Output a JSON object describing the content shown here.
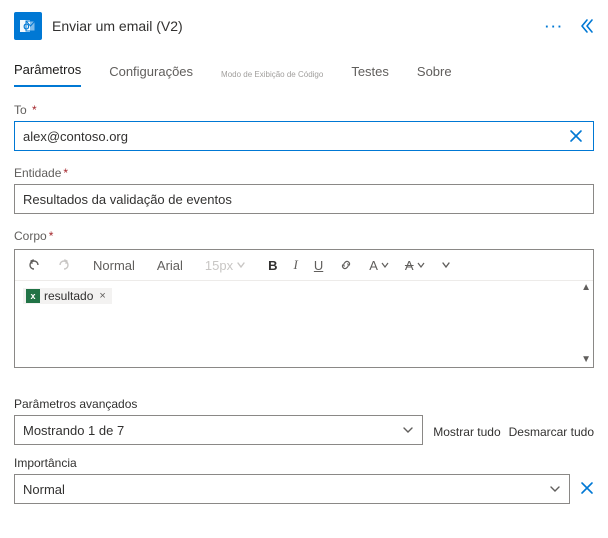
{
  "header": {
    "title": "Enviar um email (V2)"
  },
  "tabs": {
    "parametros": "Parâmetros",
    "configuracoes": "Configurações",
    "modo_exibicao": "Modo de Exibição de Código",
    "testes": "Testes",
    "sobre": "Sobre"
  },
  "fields": {
    "to": {
      "label": "To",
      "value": "alex@contoso.org"
    },
    "entidade": {
      "label": "Entidade",
      "value": "Resultados da validação de eventos"
    },
    "corpo": {
      "label": "Corpo"
    }
  },
  "toolbar": {
    "style": "Normal",
    "font": "Arial",
    "size": "15px",
    "bold": "B",
    "italic": "I",
    "underline": "U",
    "font_color": "A",
    "highlight": "A"
  },
  "body_chip": {
    "label": "resultado"
  },
  "advanced": {
    "label": "Parâmetros avançados",
    "value": "Mostrando 1 de 7",
    "show_all": "Mostrar tudo",
    "clear_all": "Desmarcar tudo"
  },
  "importance": {
    "label": "Importância",
    "value": "Normal"
  }
}
